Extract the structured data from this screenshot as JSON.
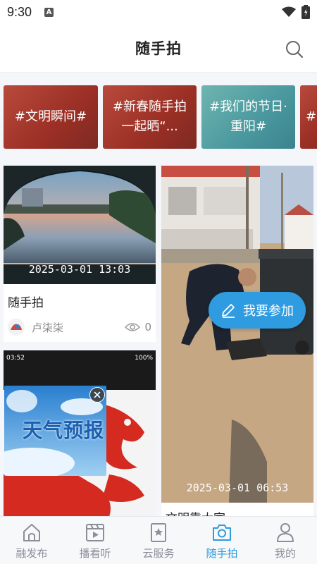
{
  "status_bar": {
    "time": "9:30",
    "app_icon": "A"
  },
  "header": {
    "title": "随手拍"
  },
  "topics": [
    {
      "label": "#文明瞬间#",
      "style": "red"
    },
    {
      "label": "#新春随手拍 一起晒“...",
      "style": "red"
    },
    {
      "label": "#我们的节日·重阳#",
      "style": "teal"
    },
    {
      "label": "#",
      "style": "red"
    }
  ],
  "feed": {
    "left_card": {
      "timestamp": "2025-03-01 13:03",
      "title": "随手拍",
      "author": "卢柒柒",
      "views": "0"
    },
    "right_card": {
      "timestamp": "2025-03-01 06:53",
      "title": "文明靠大家"
    },
    "phone_card": {
      "status_text": "03:52",
      "battery": "100%"
    }
  },
  "join_button": {
    "label": "我要参加"
  },
  "floating_video": {
    "title": "天气预报"
  },
  "tabbar": [
    {
      "label": "融发布",
      "icon": "home-icon",
      "active": false
    },
    {
      "label": "播看听",
      "icon": "video-icon",
      "active": false
    },
    {
      "label": "云服务",
      "icon": "bookmark-star-icon",
      "active": false
    },
    {
      "label": "随手拍",
      "icon": "camera-icon",
      "active": true
    },
    {
      "label": "我的",
      "icon": "person-icon",
      "active": false
    }
  ],
  "colors": {
    "accent": "#2f9be0",
    "topic_red": "#9b2f25",
    "topic_teal": "#4c9aa0"
  }
}
